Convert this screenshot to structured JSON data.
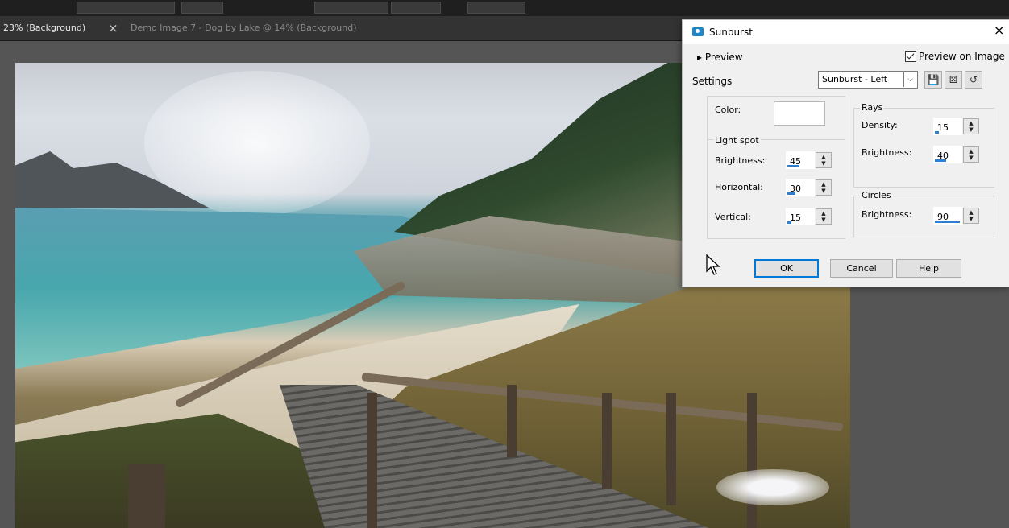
{
  "tabs": [
    {
      "label": "23% (Background)",
      "active": true
    },
    {
      "label": "Demo Image 7 - Dog by Lake @  14% (Background)",
      "active": false
    }
  ],
  "tab_close": "×",
  "dialog": {
    "title": "Sunburst",
    "close": "×",
    "preview_label": "Preview",
    "preview_on_image_label": "Preview on Image",
    "preview_on_image_checked": true,
    "settings_label": "Settings",
    "preset_value": "Sunburst - Left",
    "color_label": "Color:",
    "color_value": "#ffffff",
    "light_spot": {
      "legend": "Light spot",
      "brightness_label": "Brightness:",
      "brightness_value": "45",
      "horizontal_label": "Horizontal:",
      "horizontal_value": "30",
      "vertical_label": "Vertical:",
      "vertical_value": "15"
    },
    "rays": {
      "legend": "Rays",
      "density_label": "Density:",
      "density_value": "15",
      "brightness_label": "Brightness:",
      "brightness_value": "40"
    },
    "circles": {
      "legend": "Circles",
      "brightness_label": "Brightness:",
      "brightness_value": "90"
    },
    "buttons": {
      "ok": "OK",
      "cancel": "Cancel",
      "help": "Help"
    }
  },
  "icons": {
    "save": "save-icon",
    "randomize": "randomize-icon",
    "reset": "reset-icon"
  },
  "colors": {
    "accent": "#0078d7",
    "slider_fill": "#2f7fd1",
    "app_icon": "#1d86c7"
  }
}
